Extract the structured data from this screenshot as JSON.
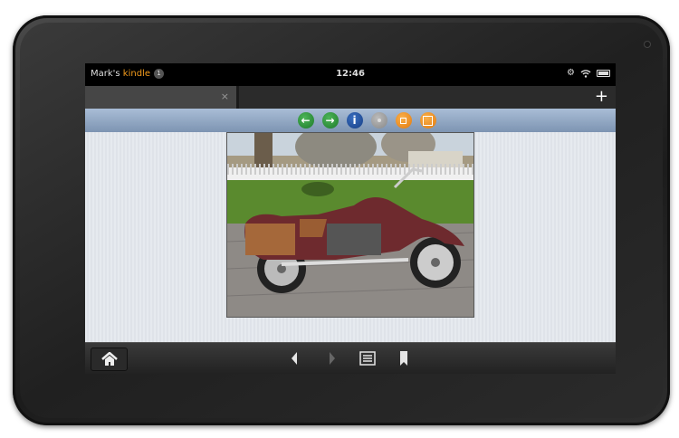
{
  "status_bar": {
    "owner_prefix": "Mark's ",
    "owner_brand": "kindle",
    "notification_count": "1",
    "time": "12:46"
  },
  "tabs": {
    "close_label": "×",
    "new_tab_label": "+"
  },
  "toolbar": {
    "buttons": [
      "back",
      "forward",
      "info",
      "disabled",
      "small-square",
      "large-square"
    ]
  },
  "colors": {
    "brand": "#f39b1c",
    "green": "#2a8a36",
    "blue": "#1f4f9a",
    "orange": "#f28a1e"
  }
}
